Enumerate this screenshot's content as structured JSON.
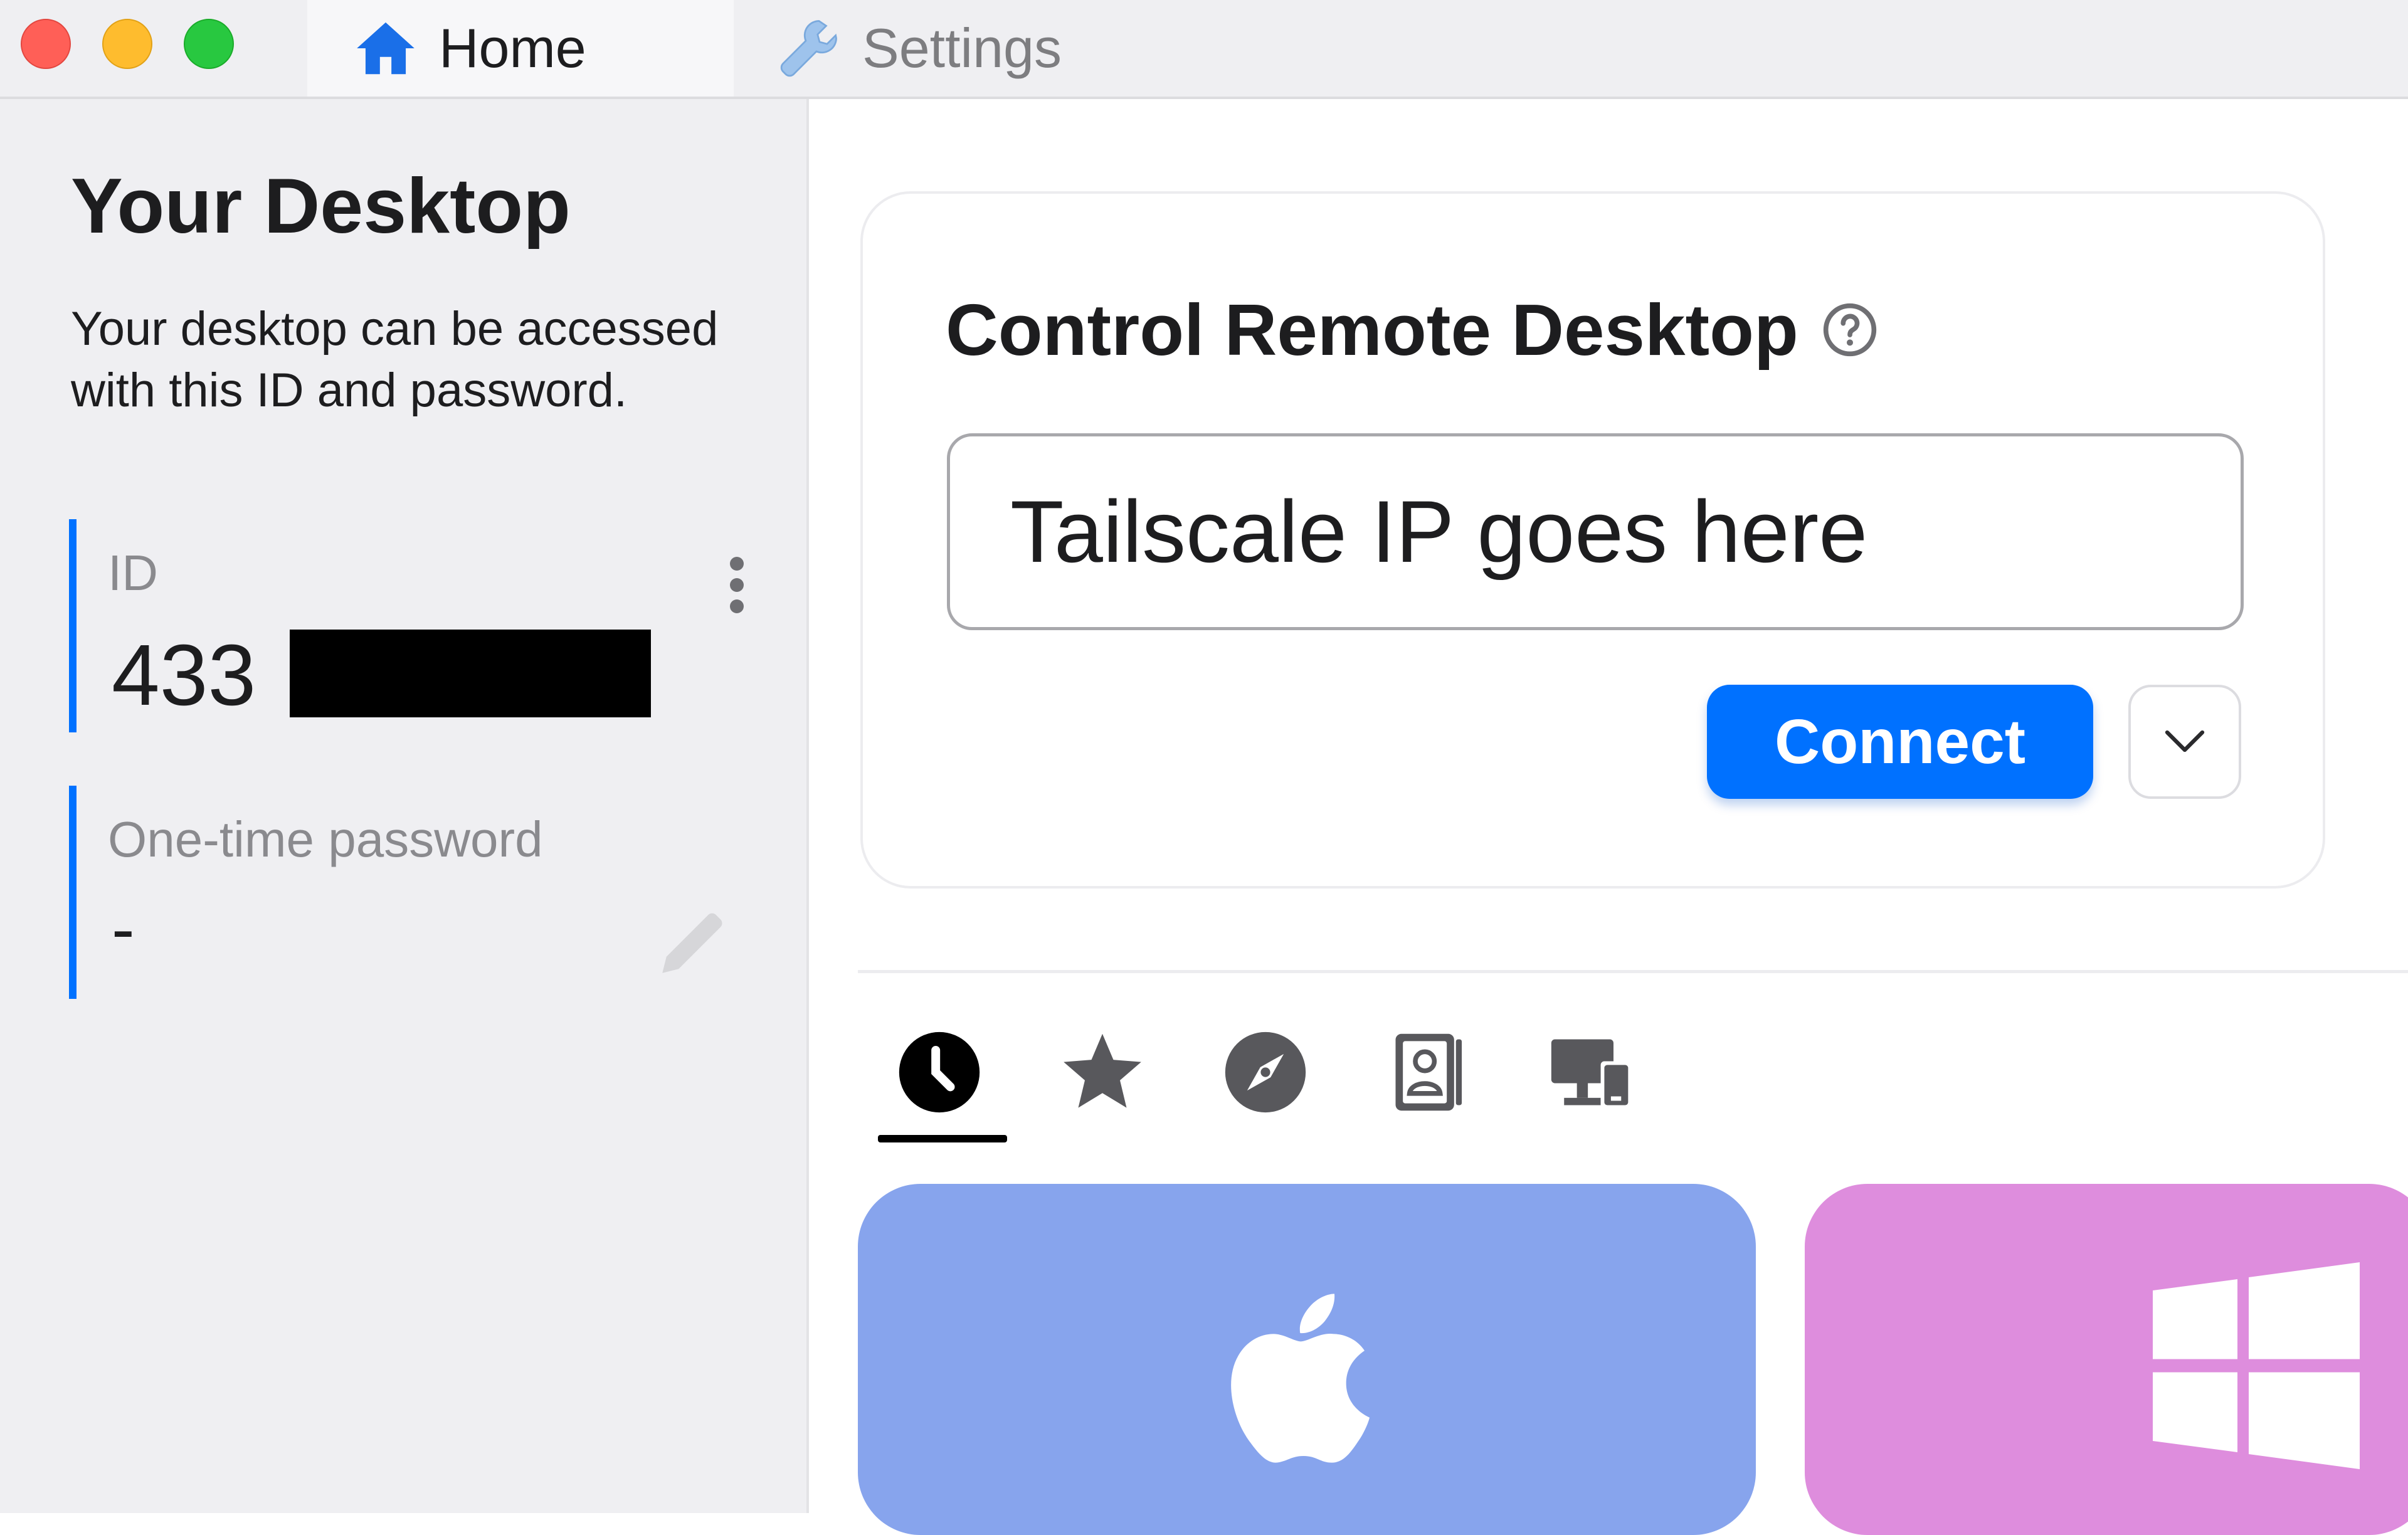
{
  "window": {
    "tabs": [
      {
        "label": "Home",
        "icon": "home-icon",
        "active": true
      },
      {
        "label": "Settings",
        "icon": "wrench-icon",
        "active": false
      }
    ]
  },
  "sidebar": {
    "title": "Your Desktop",
    "description": "Your desktop can be accessed with this ID and password.",
    "id_label": "ID",
    "id_value": "433",
    "otp_label": "One-time password",
    "otp_value": "-"
  },
  "connect": {
    "title": "Control Remote Desktop",
    "input_value": "Tailscale IP goes here",
    "connect_label": "Connect"
  },
  "peer_tabs": [
    {
      "icon": "clock-icon",
      "active": true
    },
    {
      "icon": "star-icon",
      "active": false
    },
    {
      "icon": "compass-icon",
      "active": false
    },
    {
      "icon": "address-book-icon",
      "active": false
    },
    {
      "icon": "devices-icon",
      "active": false
    }
  ],
  "peer_cards": [
    {
      "icon": "apple-logo-icon",
      "color": "#87a4ed"
    },
    {
      "icon": "windows-logo-icon",
      "color": "#de8ddd"
    }
  ],
  "colors": {
    "accent": "#0071ff",
    "sidebar_bg": "#efeff2"
  }
}
